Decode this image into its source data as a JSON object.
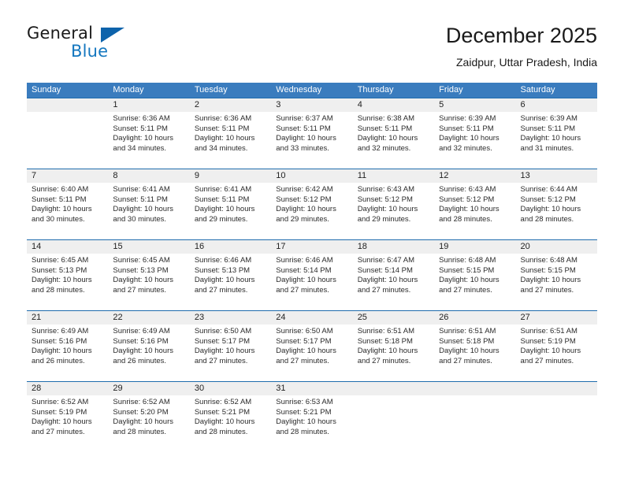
{
  "brand": {
    "name_part1": "General",
    "name_part2": "Blue",
    "triangle_color": "#0d63ab",
    "blue_color": "#1477bf"
  },
  "header": {
    "title": "December 2025",
    "subtitle": "Zaidpur, Uttar Pradesh, India"
  },
  "theme": {
    "header_row_bg": "#3a7cbe",
    "daynum_row_bg": "#efefef",
    "week_divider": "#1f6cad",
    "text": "#222222"
  },
  "weekdays": [
    "Sunday",
    "Monday",
    "Tuesday",
    "Wednesday",
    "Thursday",
    "Friday",
    "Saturday"
  ],
  "weeks": [
    {
      "days": [
        {
          "num": "",
          "sunrise": "",
          "sunset": "",
          "daylight": "",
          "empty": true
        },
        {
          "num": "1",
          "sunrise": "Sunrise: 6:36 AM",
          "sunset": "Sunset: 5:11 PM",
          "daylight": "Daylight: 10 hours and 34 minutes."
        },
        {
          "num": "2",
          "sunrise": "Sunrise: 6:36 AM",
          "sunset": "Sunset: 5:11 PM",
          "daylight": "Daylight: 10 hours and 34 minutes."
        },
        {
          "num": "3",
          "sunrise": "Sunrise: 6:37 AM",
          "sunset": "Sunset: 5:11 PM",
          "daylight": "Daylight: 10 hours and 33 minutes."
        },
        {
          "num": "4",
          "sunrise": "Sunrise: 6:38 AM",
          "sunset": "Sunset: 5:11 PM",
          "daylight": "Daylight: 10 hours and 32 minutes."
        },
        {
          "num": "5",
          "sunrise": "Sunrise: 6:39 AM",
          "sunset": "Sunset: 5:11 PM",
          "daylight": "Daylight: 10 hours and 32 minutes."
        },
        {
          "num": "6",
          "sunrise": "Sunrise: 6:39 AM",
          "sunset": "Sunset: 5:11 PM",
          "daylight": "Daylight: 10 hours and 31 minutes."
        }
      ]
    },
    {
      "days": [
        {
          "num": "7",
          "sunrise": "Sunrise: 6:40 AM",
          "sunset": "Sunset: 5:11 PM",
          "daylight": "Daylight: 10 hours and 30 minutes."
        },
        {
          "num": "8",
          "sunrise": "Sunrise: 6:41 AM",
          "sunset": "Sunset: 5:11 PM",
          "daylight": "Daylight: 10 hours and 30 minutes."
        },
        {
          "num": "9",
          "sunrise": "Sunrise: 6:41 AM",
          "sunset": "Sunset: 5:11 PM",
          "daylight": "Daylight: 10 hours and 29 minutes."
        },
        {
          "num": "10",
          "sunrise": "Sunrise: 6:42 AM",
          "sunset": "Sunset: 5:12 PM",
          "daylight": "Daylight: 10 hours and 29 minutes."
        },
        {
          "num": "11",
          "sunrise": "Sunrise: 6:43 AM",
          "sunset": "Sunset: 5:12 PM",
          "daylight": "Daylight: 10 hours and 29 minutes."
        },
        {
          "num": "12",
          "sunrise": "Sunrise: 6:43 AM",
          "sunset": "Sunset: 5:12 PM",
          "daylight": "Daylight: 10 hours and 28 minutes."
        },
        {
          "num": "13",
          "sunrise": "Sunrise: 6:44 AM",
          "sunset": "Sunset: 5:12 PM",
          "daylight": "Daylight: 10 hours and 28 minutes."
        }
      ]
    },
    {
      "days": [
        {
          "num": "14",
          "sunrise": "Sunrise: 6:45 AM",
          "sunset": "Sunset: 5:13 PM",
          "daylight": "Daylight: 10 hours and 28 minutes."
        },
        {
          "num": "15",
          "sunrise": "Sunrise: 6:45 AM",
          "sunset": "Sunset: 5:13 PM",
          "daylight": "Daylight: 10 hours and 27 minutes."
        },
        {
          "num": "16",
          "sunrise": "Sunrise: 6:46 AM",
          "sunset": "Sunset: 5:13 PM",
          "daylight": "Daylight: 10 hours and 27 minutes."
        },
        {
          "num": "17",
          "sunrise": "Sunrise: 6:46 AM",
          "sunset": "Sunset: 5:14 PM",
          "daylight": "Daylight: 10 hours and 27 minutes."
        },
        {
          "num": "18",
          "sunrise": "Sunrise: 6:47 AM",
          "sunset": "Sunset: 5:14 PM",
          "daylight": "Daylight: 10 hours and 27 minutes."
        },
        {
          "num": "19",
          "sunrise": "Sunrise: 6:48 AM",
          "sunset": "Sunset: 5:15 PM",
          "daylight": "Daylight: 10 hours and 27 minutes."
        },
        {
          "num": "20",
          "sunrise": "Sunrise: 6:48 AM",
          "sunset": "Sunset: 5:15 PM",
          "daylight": "Daylight: 10 hours and 27 minutes."
        }
      ]
    },
    {
      "days": [
        {
          "num": "21",
          "sunrise": "Sunrise: 6:49 AM",
          "sunset": "Sunset: 5:16 PM",
          "daylight": "Daylight: 10 hours and 26 minutes."
        },
        {
          "num": "22",
          "sunrise": "Sunrise: 6:49 AM",
          "sunset": "Sunset: 5:16 PM",
          "daylight": "Daylight: 10 hours and 26 minutes."
        },
        {
          "num": "23",
          "sunrise": "Sunrise: 6:50 AM",
          "sunset": "Sunset: 5:17 PM",
          "daylight": "Daylight: 10 hours and 27 minutes."
        },
        {
          "num": "24",
          "sunrise": "Sunrise: 6:50 AM",
          "sunset": "Sunset: 5:17 PM",
          "daylight": "Daylight: 10 hours and 27 minutes."
        },
        {
          "num": "25",
          "sunrise": "Sunrise: 6:51 AM",
          "sunset": "Sunset: 5:18 PM",
          "daylight": "Daylight: 10 hours and 27 minutes."
        },
        {
          "num": "26",
          "sunrise": "Sunrise: 6:51 AM",
          "sunset": "Sunset: 5:18 PM",
          "daylight": "Daylight: 10 hours and 27 minutes."
        },
        {
          "num": "27",
          "sunrise": "Sunrise: 6:51 AM",
          "sunset": "Sunset: 5:19 PM",
          "daylight": "Daylight: 10 hours and 27 minutes."
        }
      ]
    },
    {
      "days": [
        {
          "num": "28",
          "sunrise": "Sunrise: 6:52 AM",
          "sunset": "Sunset: 5:19 PM",
          "daylight": "Daylight: 10 hours and 27 minutes."
        },
        {
          "num": "29",
          "sunrise": "Sunrise: 6:52 AM",
          "sunset": "Sunset: 5:20 PM",
          "daylight": "Daylight: 10 hours and 28 minutes."
        },
        {
          "num": "30",
          "sunrise": "Sunrise: 6:52 AM",
          "sunset": "Sunset: 5:21 PM",
          "daylight": "Daylight: 10 hours and 28 minutes."
        },
        {
          "num": "31",
          "sunrise": "Sunrise: 6:53 AM",
          "sunset": "Sunset: 5:21 PM",
          "daylight": "Daylight: 10 hours and 28 minutes."
        },
        {
          "num": "",
          "sunrise": "",
          "sunset": "",
          "daylight": "",
          "empty": true
        },
        {
          "num": "",
          "sunrise": "",
          "sunset": "",
          "daylight": "",
          "empty": true
        },
        {
          "num": "",
          "sunrise": "",
          "sunset": "",
          "daylight": "",
          "empty": true
        }
      ]
    }
  ]
}
